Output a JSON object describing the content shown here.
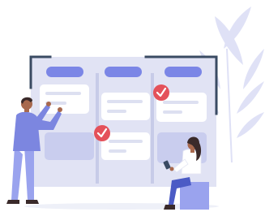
{
  "illustration": {
    "subject": "kanban-board-planning",
    "board": {
      "columns": [
        {
          "header_color": "#7b86e6",
          "cards": [
            "card",
            "placeholder"
          ]
        },
        {
          "header_color": "#7b86e6",
          "cards": [
            "card",
            "card-checked"
          ]
        },
        {
          "header_color": "#7b86e6",
          "cards": [
            "card-checked",
            "placeholder"
          ]
        }
      ],
      "checked_card_count": 2
    },
    "people": [
      {
        "role": "presenter",
        "pose": "standing-pointing"
      },
      {
        "role": "viewer",
        "pose": "sitting-with-phone"
      }
    ],
    "decoration": [
      "leaf-plant"
    ]
  },
  "colors": {
    "board_bg": "#e1e3f4",
    "board_frame": "#3a4b63",
    "column_divider": "#c7cbe8",
    "accent": "#7b86e6",
    "card": "#ffffff",
    "card_line": "#dde0f1",
    "placeholder": "#c9cdee",
    "check": "#e4515a",
    "leaf": "#dfe1f6",
    "skin": "#a8694e",
    "shirt_presenter": "#7c86e0",
    "pants_presenter": "#9aa3ee",
    "shirt_viewer": "#ffffff",
    "pants_viewer": "#4b5bc5",
    "seat": "#9aa3ee",
    "hair": "#3a2a2a"
  }
}
